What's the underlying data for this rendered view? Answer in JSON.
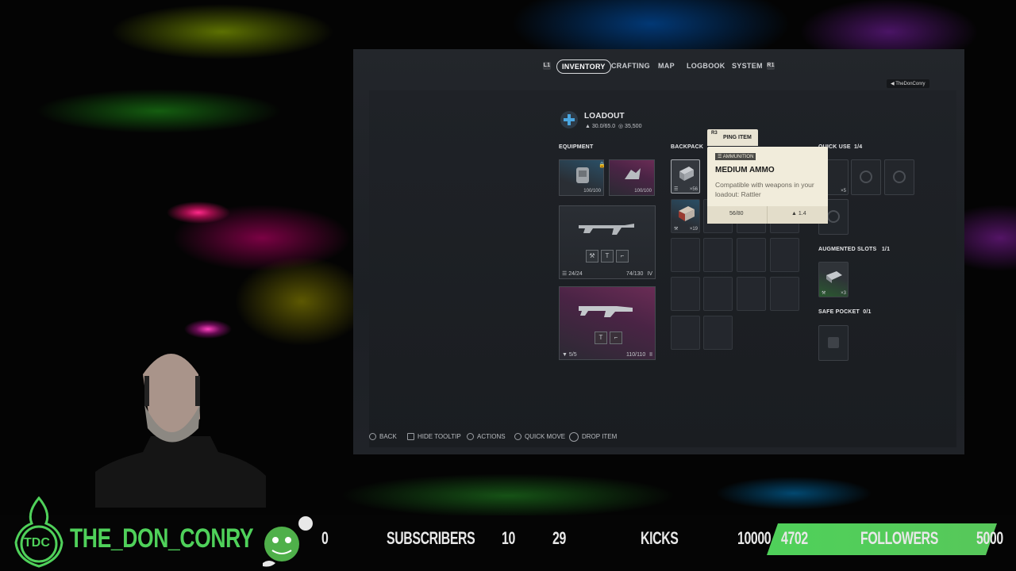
{
  "game": {
    "nav": {
      "left_button": "L1",
      "tabs": [
        "INVENTORY",
        "CRAFTING",
        "MAP",
        "LOGBOOK",
        "SYSTEM"
      ],
      "active_tab": "INVENTORY",
      "right_button": "R1"
    },
    "user_tag": "TheDonConry",
    "loadout": {
      "title": "LOADOUT",
      "weight": "30.0/65.0",
      "currency": "35,500"
    },
    "equipment": {
      "label": "EQUIPMENT",
      "shield": {
        "durability": "100/100"
      },
      "augment": {
        "durability": "100/100"
      },
      "weapon1": {
        "ammo": "24/24",
        "reserve": "74/130",
        "tier": "IV"
      },
      "weapon2": {
        "ammo": "5/5",
        "reserve": "110/110",
        "tier": "II"
      }
    },
    "backpack": {
      "label": "BACKPACK",
      "item1_count": "×56",
      "item2_count": "×19"
    },
    "tooltip": {
      "ping_button": "R3",
      "ping_label": "PING ITEM",
      "category": "AMMUNITION",
      "title": "MEDIUM AMMO",
      "description": "Compatible with weapons in your loadout: Rattler",
      "stack": "56/80",
      "weight": "1.4"
    },
    "quick_use": {
      "label": "QUICK USE",
      "count": "1/4",
      "item_count": "×5"
    },
    "augmented_slots": {
      "label": "AUGMENTED SLOTS",
      "count": "1/1",
      "item_count": "×3"
    },
    "safe_pocket": {
      "label": "SAFE POCKET",
      "count": "0/1"
    },
    "hints": [
      "BACK",
      "HIDE TOOLTIP",
      "ACTIONS",
      "QUICK MOVE",
      "DROP ITEM"
    ]
  },
  "stream_bar": {
    "logo": "TDC",
    "channel": "THE_DON_CONRY",
    "subs_value": "0",
    "subs_label": "SUBSCRIBERS",
    "subs_goal": "10",
    "kicks_value": "29",
    "kicks_label": "KICKS",
    "kicks_goal": "10000",
    "followers_value": "4702",
    "followers_label": "FOLLOWERS",
    "followers_goal": "5000",
    "followers_progress": 0.9404
  },
  "colors": {
    "accent_green": "#4fd15a",
    "tooltip_bg": "#f1ecdb",
    "rarity_pink": "#d0308a",
    "rarity_blue": "#2aa0d8"
  }
}
